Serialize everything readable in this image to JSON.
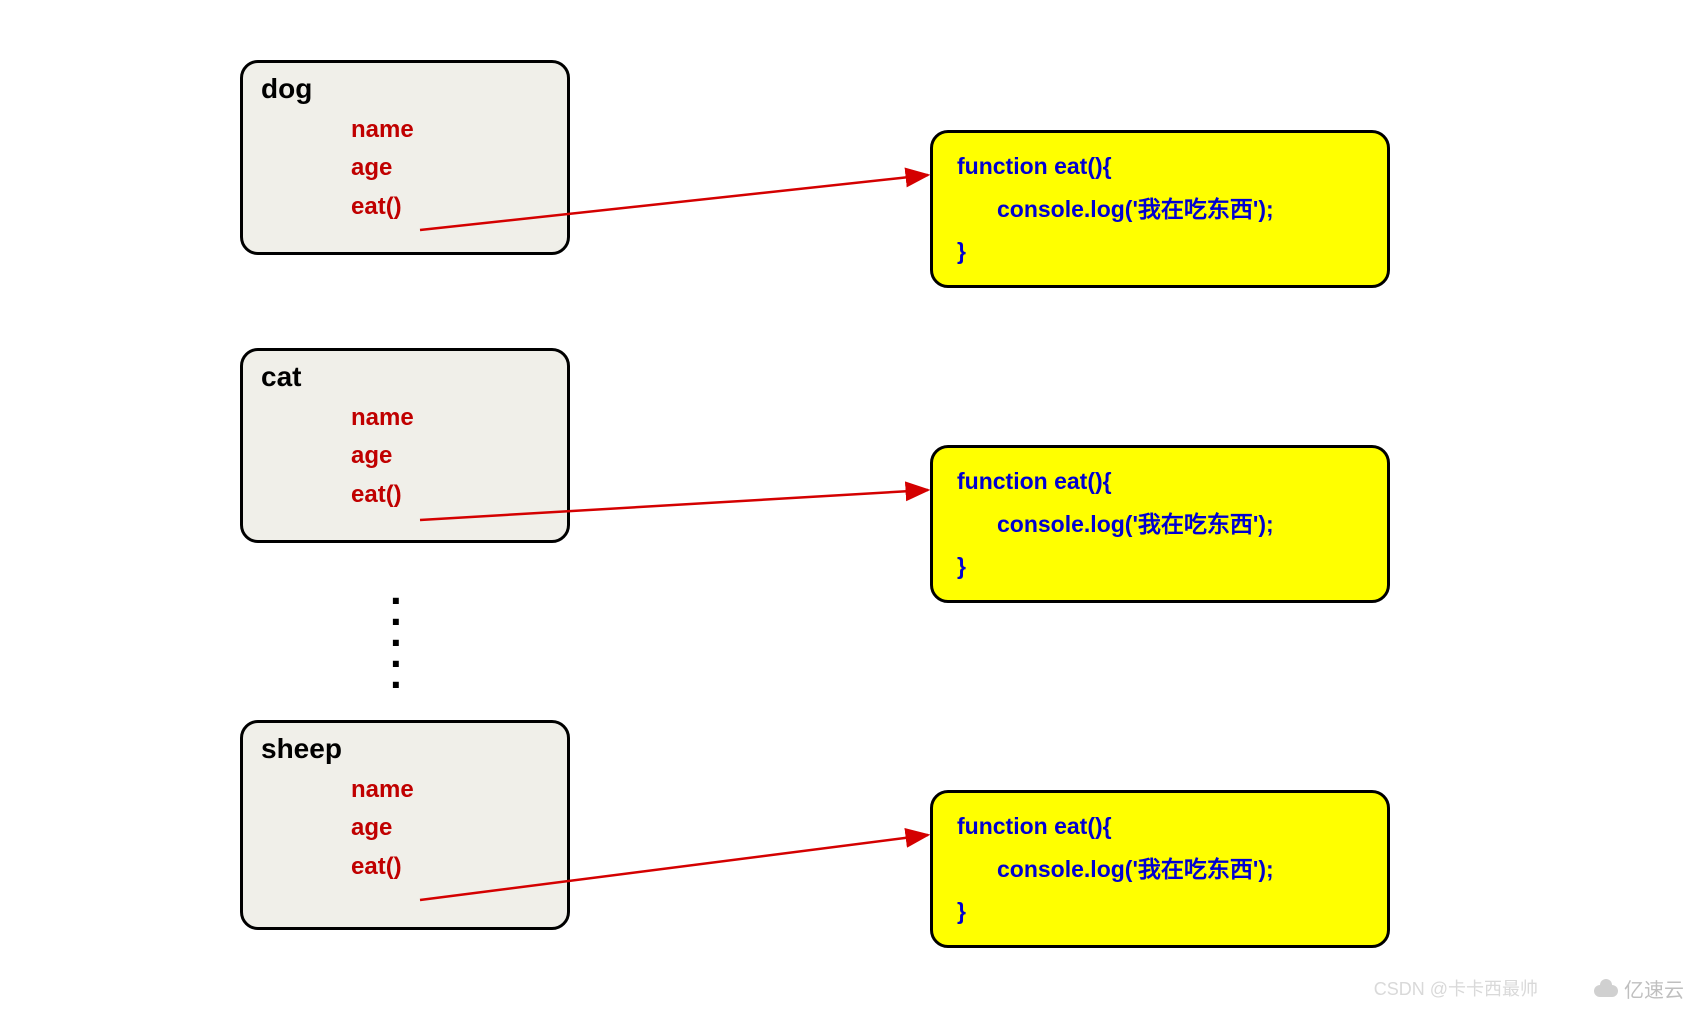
{
  "objects": [
    {
      "title": "dog",
      "props": [
        "name",
        "age",
        "eat()"
      ]
    },
    {
      "title": "cat",
      "props": [
        "name",
        "age",
        "eat()"
      ]
    },
    {
      "title": "sheep",
      "props": [
        "name",
        "age",
        "eat()"
      ]
    }
  ],
  "func": {
    "line1": "function eat(){",
    "line2": "console.log('我在吃东西');",
    "line3": "}"
  },
  "watermark": {
    "csdn": "CSDN @卡卡西最帅",
    "yisu": "亿速云"
  }
}
